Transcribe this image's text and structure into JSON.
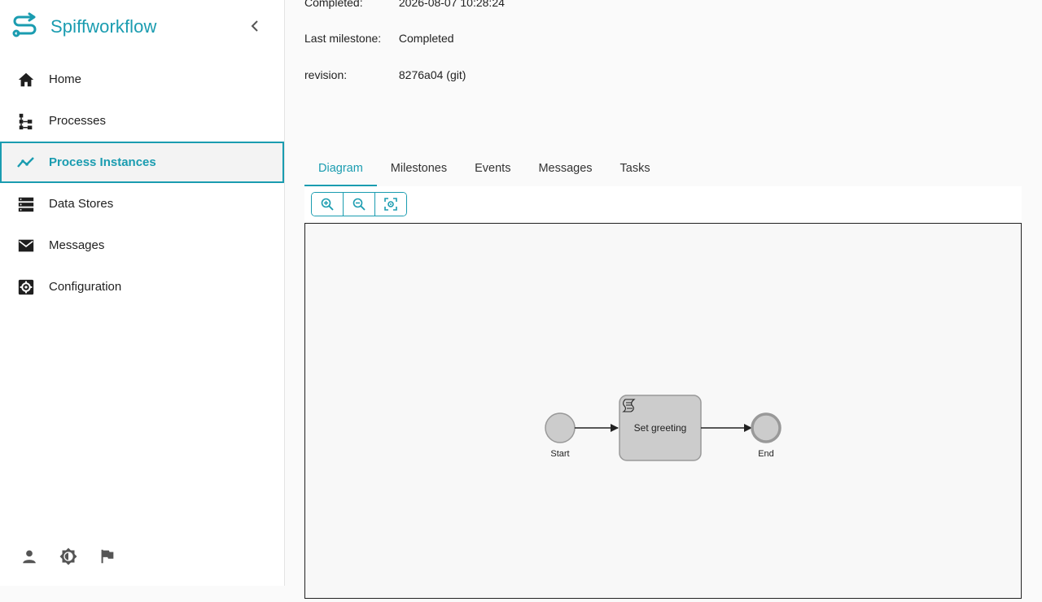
{
  "app": {
    "name": "Spiffworkflow"
  },
  "sidebar": {
    "items": [
      {
        "label": "Home",
        "icon": "home-icon"
      },
      {
        "label": "Processes",
        "icon": "processes-icon"
      },
      {
        "label": "Process Instances",
        "icon": "process-instances-icon",
        "active": true
      },
      {
        "label": "Data Stores",
        "icon": "data-stores-icon"
      },
      {
        "label": "Messages",
        "icon": "messages-icon"
      },
      {
        "label": "Configuration",
        "icon": "configuration-icon"
      }
    ],
    "footer": [
      "user-icon",
      "theme-icon",
      "flag-icon"
    ]
  },
  "details": {
    "completed_label": "Completed:",
    "completed_value": "2026-08-07 10:28:24",
    "milestone_label": "Last milestone:",
    "milestone_value": "Completed",
    "revision_label": "revision:",
    "revision_value": "8276a04 (git)"
  },
  "tabs": [
    "Diagram",
    "Milestones",
    "Events",
    "Messages",
    "Tasks"
  ],
  "active_tab": "Diagram",
  "diagram": {
    "start_label": "Start",
    "task_label": "Set greeting",
    "end_label": "End"
  },
  "colors": {
    "accent": "#1a9cb0",
    "node_fill": "#cccccc",
    "node_stroke": "#999999"
  }
}
